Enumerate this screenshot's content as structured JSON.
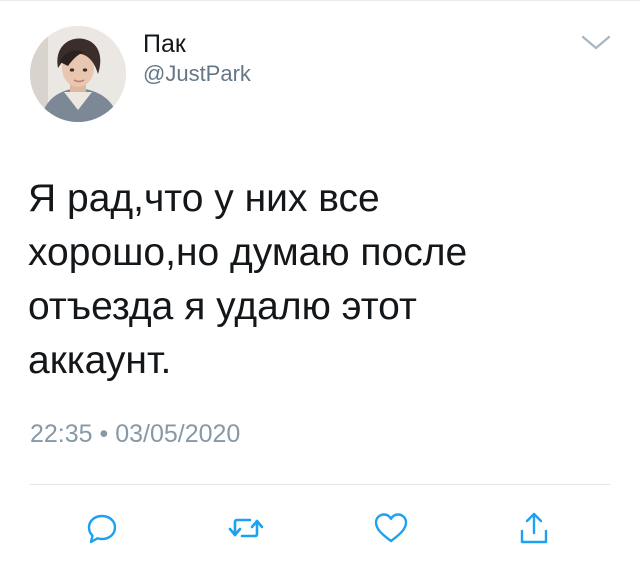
{
  "tweet": {
    "author": {
      "display_name": "Пак",
      "handle": "@JustPark",
      "avatar_icon": "profile-photo"
    },
    "text_lines": [
      "Я рад,что у них все",
      "хорошо,но думаю после",
      "отъезда я удалю этот",
      "аккаунт."
    ],
    "timestamp": "22:35 • 03/05/2020",
    "menu_icon": "chevron-down-icon",
    "actions": [
      {
        "name": "reply",
        "icon": "reply-icon"
      },
      {
        "name": "retweet",
        "icon": "retweet-icon"
      },
      {
        "name": "like",
        "icon": "heart-icon"
      },
      {
        "name": "share",
        "icon": "share-icon"
      }
    ]
  },
  "colors": {
    "text_primary": "#14171a",
    "text_secondary": "#657786",
    "timestamp": "#8899a6",
    "icon": "#1da1f2",
    "chevron": "#aab8c2",
    "divider": "#e1e8ed"
  }
}
